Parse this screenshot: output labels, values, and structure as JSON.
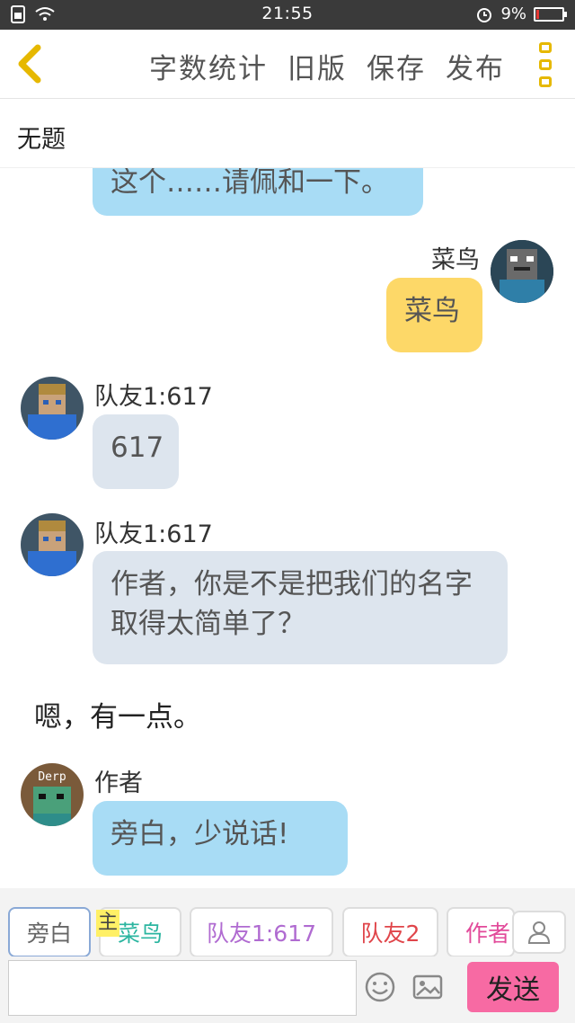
{
  "status_bar": {
    "time": "21:55",
    "battery": "9%",
    "battery_level": 0.09
  },
  "toolbar": {
    "actions": [
      "字数统计",
      "旧版",
      "保存",
      "发布"
    ]
  },
  "title": "无题",
  "messages": {
    "m0": {
      "text": "这个……请佩和一下。"
    },
    "m1": {
      "name": "菜鸟",
      "text": "菜鸟"
    },
    "m2": {
      "name": "队友1:617",
      "text": "617"
    },
    "m3": {
      "name": "队友1:617",
      "text": "作者，你是不是把我们的名字取得太简单了？"
    },
    "m4": {
      "text": "嗯，有一点。"
    },
    "m5": {
      "name": "作者",
      "text": "旁白，少说话!"
    }
  },
  "avatars": {
    "author_caption": "Derp"
  },
  "roles": {
    "items": [
      {
        "label": "旁白",
        "color": "#666666"
      },
      {
        "label": "菜鸟",
        "color": "#2bb5a0"
      },
      {
        "label": "队友1:617",
        "color": "#b06bd1"
      },
      {
        "label": "队友2",
        "color": "#e0454a"
      },
      {
        "label": "作者",
        "color": "#e24a9a"
      }
    ],
    "main_tag": "主"
  },
  "input": {
    "value": "",
    "send_label": "发送"
  },
  "colors": {
    "accent": "#e6b800",
    "send": "#f76aa3",
    "bubble_blue": "#a8dcf5",
    "bubble_gray": "#dde5ee",
    "bubble_yellow": "#fdd868"
  }
}
